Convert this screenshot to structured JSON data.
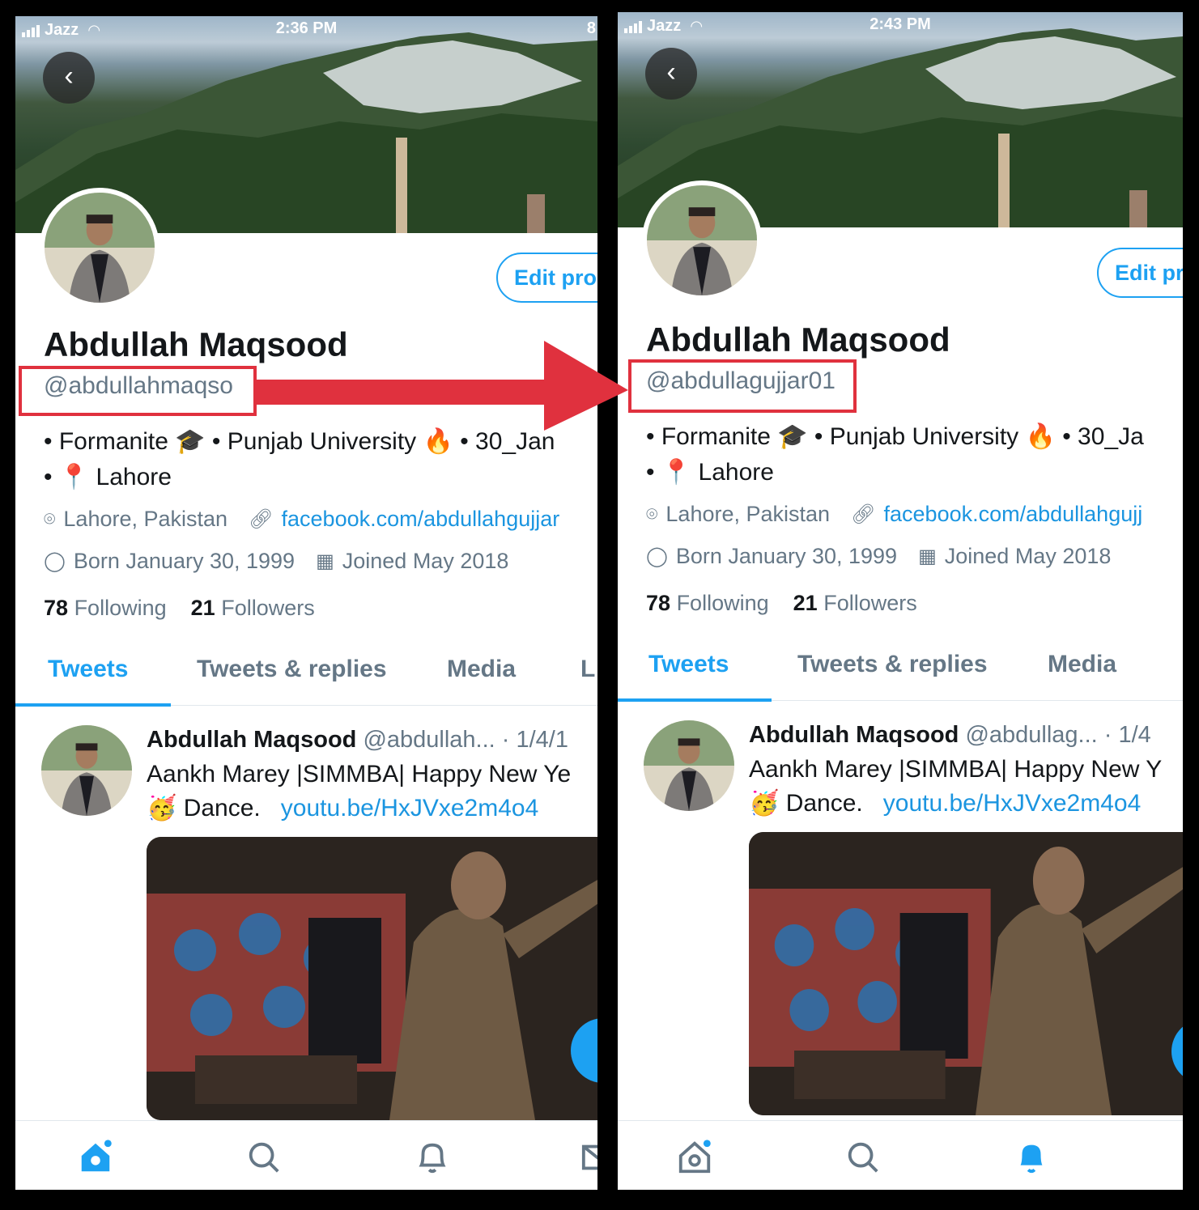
{
  "colors": {
    "accent": "#1da1f2",
    "link": "#1b95e0",
    "highlight": "#e0313e",
    "muted": "#657786"
  },
  "left": {
    "status": {
      "carrier": "Jazz",
      "time": "2:36 PM",
      "battery": "8"
    },
    "edit_label": "Edit pro",
    "name": "Abdullah Maqsood",
    "handle": "@abdullahmaqso",
    "bio_line1": "• Formanite 🎓 • Punjab University 🔥 • 30_Jan",
    "bio_line2": "• 📍 Lahore",
    "location": "Lahore, Pakistan",
    "website": "facebook.com/abdullahgujjar",
    "born": "Born January 30, 1999",
    "joined": "Joined May 2018",
    "following_count": "78",
    "following_label": "Following",
    "followers_count": "21",
    "followers_label": "Followers",
    "tabs": [
      "Tweets",
      "Tweets & replies",
      "Media",
      "L"
    ],
    "tweet": {
      "name": "Abdullah Maqsood",
      "handle": "@abdullah...",
      "date": "· 1/4/1",
      "line1": "Aankh Marey |SIMMBA| Happy New Ye",
      "line2_pre": "🥳 Dance.",
      "link": "youtu.be/HxJVxe2m4o4"
    }
  },
  "right": {
    "status": {
      "carrier": "Jazz",
      "time": "2:43 PM"
    },
    "edit_label": "Edit pr",
    "name": "Abdullah Maqsood",
    "handle": "@abdullagujjar01",
    "bio_line1": "• Formanite 🎓 • Punjab University 🔥 • 30_Ja",
    "bio_line2": "• 📍 Lahore",
    "location": "Lahore, Pakistan",
    "website": "facebook.com/abdullahgujj",
    "born": "Born January 30, 1999",
    "joined": "Joined May 2018",
    "following_count": "78",
    "following_label": "Following",
    "followers_count": "21",
    "followers_label": "Followers",
    "tabs": [
      "Tweets",
      "Tweets & replies",
      "Media"
    ],
    "tweet": {
      "name": "Abdullah Maqsood",
      "handle": "@abdullag...",
      "date": "· 1/4",
      "line1": "Aankh Marey |SIMMBA| Happy New Y",
      "line2_pre": "🥳 Dance.",
      "link": "youtu.be/HxJVxe2m4o4"
    }
  },
  "icons": {
    "back": "chevron-left-icon",
    "location": "map-pin-icon",
    "website": "link-icon",
    "born": "balloon-icon",
    "joined": "calendar-icon",
    "nav": [
      "home-icon",
      "search-icon",
      "bell-icon",
      "mail-icon"
    ]
  }
}
